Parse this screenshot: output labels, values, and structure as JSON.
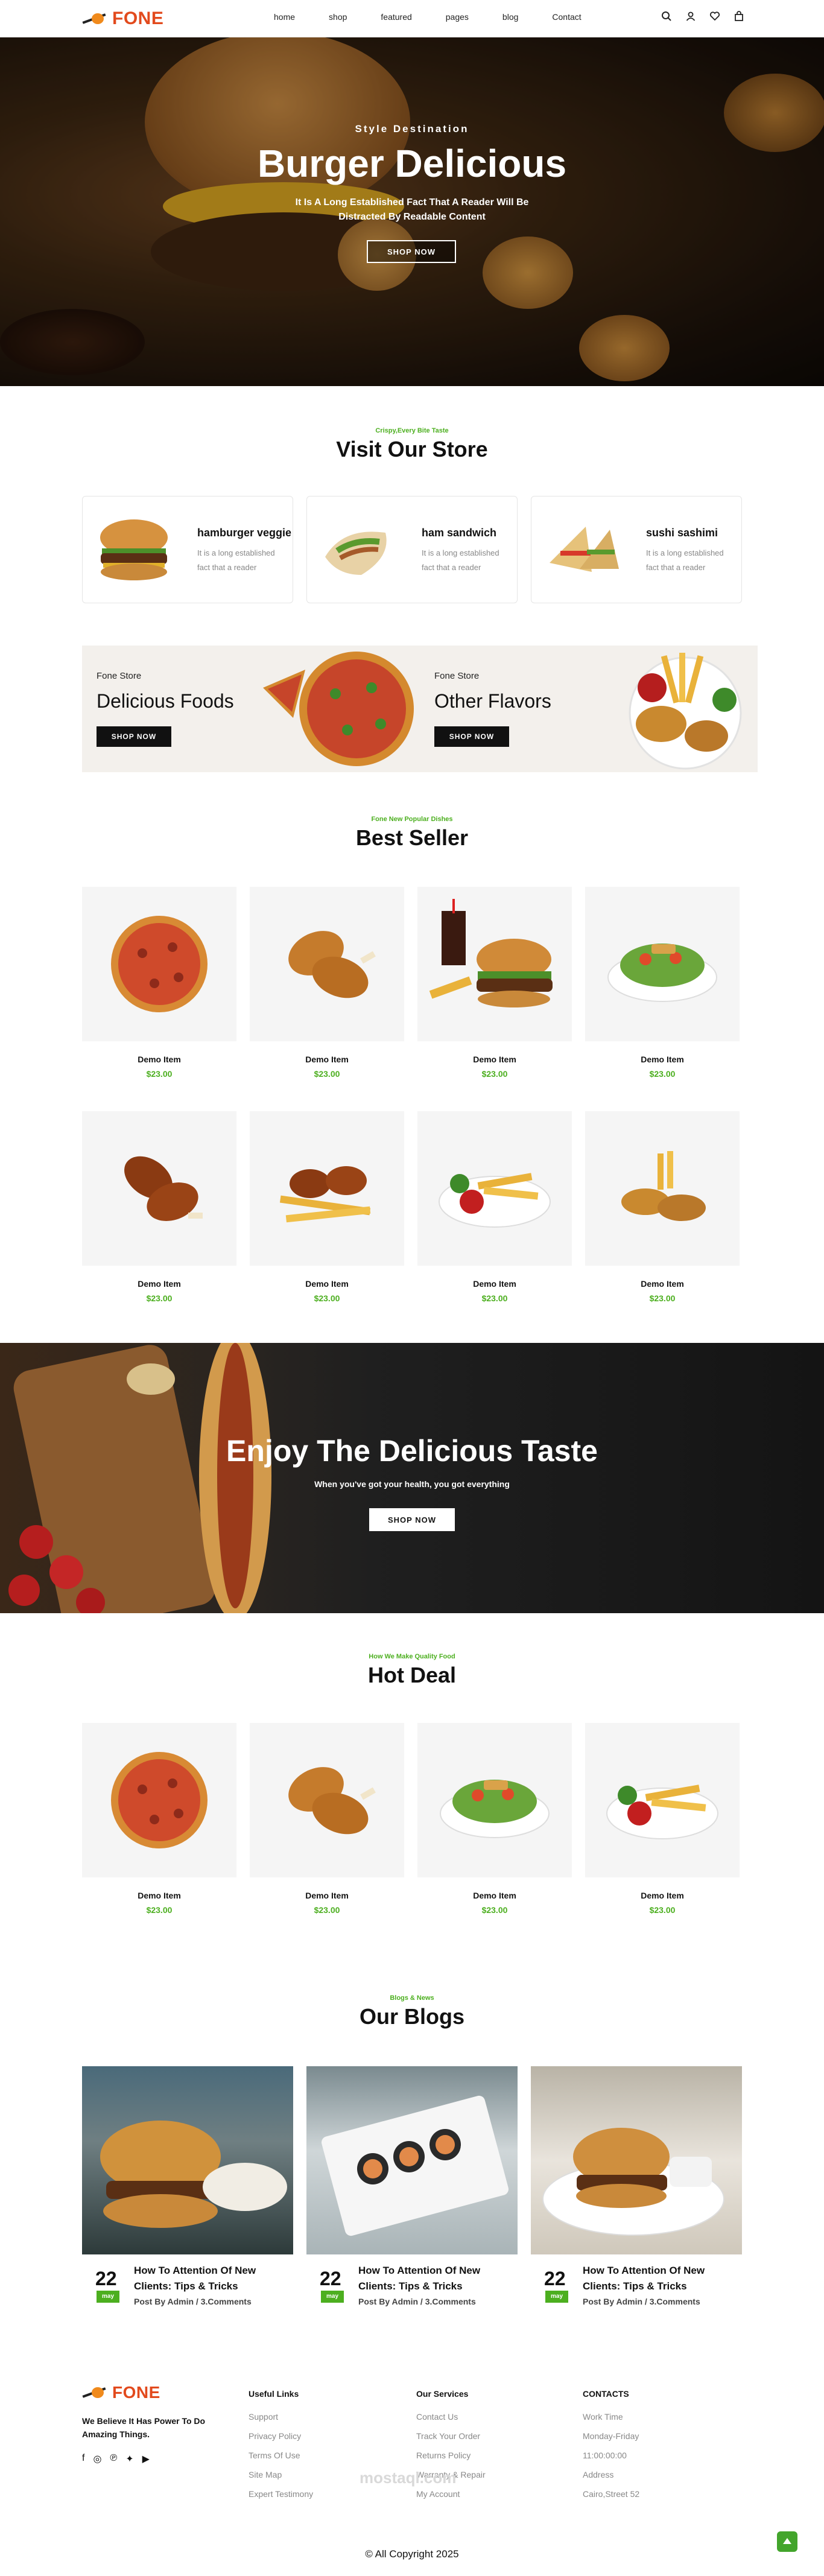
{
  "brand": {
    "logo": "FONE",
    "accent": "#e24a1d",
    "green": "#4caf1f"
  },
  "nav": [
    "home",
    "shop",
    "featured",
    "pages",
    "blog",
    "Contact"
  ],
  "header_icons": [
    "search-icon",
    "user-icon",
    "heart-icon",
    "bag-icon"
  ],
  "hero": {
    "kicker": "Style Destination",
    "title": "Burger Delicious",
    "subtitle_line1": "It Is A Long Established Fact That A Reader Will Be",
    "subtitle_line2": "Distracted By Readable Content",
    "button": "SHOP NOW"
  },
  "store": {
    "kicker": "Crispy,Every Bite Taste",
    "title": "Visit Our Store",
    "cards": [
      {
        "name": "hamburger veggie",
        "desc": "It is a long established fact that a reader"
      },
      {
        "name": "ham sandwich",
        "desc": "It is a long established fact that a reader"
      },
      {
        "name": "sushi sashimi",
        "desc": "It is a long established fact that a reader"
      }
    ]
  },
  "promos": [
    {
      "store": "Fone Store",
      "title": "Delicious Foods",
      "button": "SHOP NOW"
    },
    {
      "store": "Fone Store",
      "title": "Other Flavors",
      "button": "SHOP NOW"
    }
  ],
  "best_seller": {
    "kicker": "Fone New Popular Dishes",
    "title": "Best Seller",
    "items": [
      {
        "name": "Demo Item",
        "price": "$23.00"
      },
      {
        "name": "Demo Item",
        "price": "$23.00"
      },
      {
        "name": "Demo Item",
        "price": "$23.00"
      },
      {
        "name": "Demo Item",
        "price": "$23.00"
      },
      {
        "name": "Demo Item",
        "price": "$23.00"
      },
      {
        "name": "Demo Item",
        "price": "$23.00"
      },
      {
        "name": "Demo Item",
        "price": "$23.00"
      },
      {
        "name": "Demo Item",
        "price": "$23.00"
      }
    ]
  },
  "taste": {
    "title": "Enjoy The Delicious Taste",
    "subtitle": "When you've got your health, you got everything",
    "button": "SHOP NOW"
  },
  "hot_deal": {
    "kicker": "How We Make Quality Food",
    "title": "Hot Deal",
    "items": [
      {
        "name": "Demo Item",
        "price": "$23.00"
      },
      {
        "name": "Demo Item",
        "price": "$23.00"
      },
      {
        "name": "Demo Item",
        "price": "$23.00"
      },
      {
        "name": "Demo Item",
        "price": "$23.00"
      }
    ]
  },
  "blogs": {
    "kicker": "Blogs & News",
    "title": "Our Blogs",
    "posts": [
      {
        "day": "22",
        "month": "may",
        "title": "How To Attention Of New Clients: Tips & Tricks",
        "byline": "Post By Admin / 3.Comments"
      },
      {
        "day": "22",
        "month": "may",
        "title": "How To Attention Of New Clients: Tips & Tricks",
        "byline": "Post By Admin / 3.Comments"
      },
      {
        "day": "22",
        "month": "may",
        "title": "How To Attention Of New Clients: Tips & Tricks",
        "byline": "Post By Admin / 3.Comments"
      }
    ]
  },
  "footer": {
    "tagline": "We Believe It Has Power To Do Amazing Things.",
    "social": [
      "facebook-icon",
      "instagram-icon",
      "pinterest-icon",
      "twitter-icon",
      "youtube-icon"
    ],
    "useful_links": {
      "title": "Useful Links",
      "links": [
        "Support",
        "Privacy Policy",
        "Terms Of Use",
        "Site Map",
        "Expert Testimony"
      ]
    },
    "services": {
      "title": "Our Services",
      "links": [
        "Contact Us",
        "Track Your Order",
        "Returns Policy",
        "Warranty & Repair",
        "My Account"
      ]
    },
    "contacts": {
      "title": "CONTACTS",
      "links": [
        "Work Time",
        "Monday-Friday",
        "11:00:00:00",
        "Address",
        "Cairo,Street 52"
      ]
    },
    "copyright": "© All Copyright 2025",
    "watermark": "mostaql.com"
  }
}
